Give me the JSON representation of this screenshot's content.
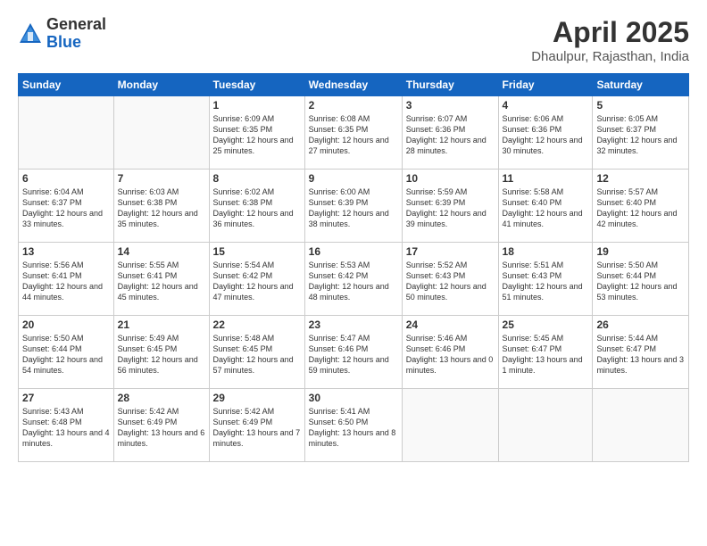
{
  "logo": {
    "general": "General",
    "blue": "Blue"
  },
  "title": "April 2025",
  "subtitle": "Dhaulpur, Rajasthan, India",
  "days_of_week": [
    "Sunday",
    "Monday",
    "Tuesday",
    "Wednesday",
    "Thursday",
    "Friday",
    "Saturday"
  ],
  "weeks": [
    [
      {
        "day": "",
        "info": ""
      },
      {
        "day": "",
        "info": ""
      },
      {
        "day": "1",
        "info": "Sunrise: 6:09 AM\nSunset: 6:35 PM\nDaylight: 12 hours and 25 minutes."
      },
      {
        "day": "2",
        "info": "Sunrise: 6:08 AM\nSunset: 6:35 PM\nDaylight: 12 hours and 27 minutes."
      },
      {
        "day": "3",
        "info": "Sunrise: 6:07 AM\nSunset: 6:36 PM\nDaylight: 12 hours and 28 minutes."
      },
      {
        "day": "4",
        "info": "Sunrise: 6:06 AM\nSunset: 6:36 PM\nDaylight: 12 hours and 30 minutes."
      },
      {
        "day": "5",
        "info": "Sunrise: 6:05 AM\nSunset: 6:37 PM\nDaylight: 12 hours and 32 minutes."
      }
    ],
    [
      {
        "day": "6",
        "info": "Sunrise: 6:04 AM\nSunset: 6:37 PM\nDaylight: 12 hours and 33 minutes."
      },
      {
        "day": "7",
        "info": "Sunrise: 6:03 AM\nSunset: 6:38 PM\nDaylight: 12 hours and 35 minutes."
      },
      {
        "day": "8",
        "info": "Sunrise: 6:02 AM\nSunset: 6:38 PM\nDaylight: 12 hours and 36 minutes."
      },
      {
        "day": "9",
        "info": "Sunrise: 6:00 AM\nSunset: 6:39 PM\nDaylight: 12 hours and 38 minutes."
      },
      {
        "day": "10",
        "info": "Sunrise: 5:59 AM\nSunset: 6:39 PM\nDaylight: 12 hours and 39 minutes."
      },
      {
        "day": "11",
        "info": "Sunrise: 5:58 AM\nSunset: 6:40 PM\nDaylight: 12 hours and 41 minutes."
      },
      {
        "day": "12",
        "info": "Sunrise: 5:57 AM\nSunset: 6:40 PM\nDaylight: 12 hours and 42 minutes."
      }
    ],
    [
      {
        "day": "13",
        "info": "Sunrise: 5:56 AM\nSunset: 6:41 PM\nDaylight: 12 hours and 44 minutes."
      },
      {
        "day": "14",
        "info": "Sunrise: 5:55 AM\nSunset: 6:41 PM\nDaylight: 12 hours and 45 minutes."
      },
      {
        "day": "15",
        "info": "Sunrise: 5:54 AM\nSunset: 6:42 PM\nDaylight: 12 hours and 47 minutes."
      },
      {
        "day": "16",
        "info": "Sunrise: 5:53 AM\nSunset: 6:42 PM\nDaylight: 12 hours and 48 minutes."
      },
      {
        "day": "17",
        "info": "Sunrise: 5:52 AM\nSunset: 6:43 PM\nDaylight: 12 hours and 50 minutes."
      },
      {
        "day": "18",
        "info": "Sunrise: 5:51 AM\nSunset: 6:43 PM\nDaylight: 12 hours and 51 minutes."
      },
      {
        "day": "19",
        "info": "Sunrise: 5:50 AM\nSunset: 6:44 PM\nDaylight: 12 hours and 53 minutes."
      }
    ],
    [
      {
        "day": "20",
        "info": "Sunrise: 5:50 AM\nSunset: 6:44 PM\nDaylight: 12 hours and 54 minutes."
      },
      {
        "day": "21",
        "info": "Sunrise: 5:49 AM\nSunset: 6:45 PM\nDaylight: 12 hours and 56 minutes."
      },
      {
        "day": "22",
        "info": "Sunrise: 5:48 AM\nSunset: 6:45 PM\nDaylight: 12 hours and 57 minutes."
      },
      {
        "day": "23",
        "info": "Sunrise: 5:47 AM\nSunset: 6:46 PM\nDaylight: 12 hours and 59 minutes."
      },
      {
        "day": "24",
        "info": "Sunrise: 5:46 AM\nSunset: 6:46 PM\nDaylight: 13 hours and 0 minutes."
      },
      {
        "day": "25",
        "info": "Sunrise: 5:45 AM\nSunset: 6:47 PM\nDaylight: 13 hours and 1 minute."
      },
      {
        "day": "26",
        "info": "Sunrise: 5:44 AM\nSunset: 6:47 PM\nDaylight: 13 hours and 3 minutes."
      }
    ],
    [
      {
        "day": "27",
        "info": "Sunrise: 5:43 AM\nSunset: 6:48 PM\nDaylight: 13 hours and 4 minutes."
      },
      {
        "day": "28",
        "info": "Sunrise: 5:42 AM\nSunset: 6:49 PM\nDaylight: 13 hours and 6 minutes."
      },
      {
        "day": "29",
        "info": "Sunrise: 5:42 AM\nSunset: 6:49 PM\nDaylight: 13 hours and 7 minutes."
      },
      {
        "day": "30",
        "info": "Sunrise: 5:41 AM\nSunset: 6:50 PM\nDaylight: 13 hours and 8 minutes."
      },
      {
        "day": "",
        "info": ""
      },
      {
        "day": "",
        "info": ""
      },
      {
        "day": "",
        "info": ""
      }
    ]
  ]
}
